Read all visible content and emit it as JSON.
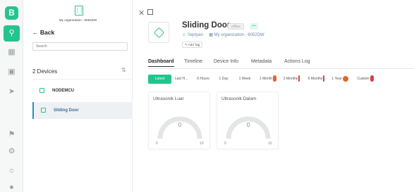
{
  "rail": {
    "logo": "B",
    "items": [
      "search-icon",
      "grid-icon",
      "building-icon",
      "send-icon",
      "megaphone-icon",
      "gear-icon",
      "settings-icon",
      "dot-icon"
    ]
  },
  "panel": {
    "org_name": "My organization - 6052DW",
    "back_label": "Back",
    "search_placeholder": "Search",
    "device_count": "2 Devices",
    "devices": [
      {
        "name": "NODEMCU",
        "active": false
      },
      {
        "name": "Sliding Door",
        "active": true
      }
    ]
  },
  "device": {
    "name": "Sliding Door",
    "status": "Offline",
    "more": "•••",
    "owner": "Septyan",
    "organization": "My organization - 6052DW",
    "add_tag": "Add Tag"
  },
  "tabs": [
    "Dashboard",
    "Timeline",
    "Device Info",
    "Metadata",
    "Actions Log"
  ],
  "active_tab": "Dashboard",
  "time_ranges": [
    "Latest",
    "Last H...",
    "6 Hours",
    "1 Day",
    "1 Week",
    "1 Month",
    "3 Months",
    "6 Months",
    "1 Year",
    "Custom"
  ],
  "active_range": "Latest",
  "widgets": [
    {
      "title": "Ultrasonik Luar",
      "value": "0",
      "min": "0",
      "max": "10"
    },
    {
      "title": "Ultrasonik Dalam",
      "value": "0",
      "min": "0",
      "max": "10"
    }
  ],
  "colors": {
    "accent": "#23c48e",
    "pro_orange": "#e8632a",
    "pro_red": "#d9413a"
  }
}
